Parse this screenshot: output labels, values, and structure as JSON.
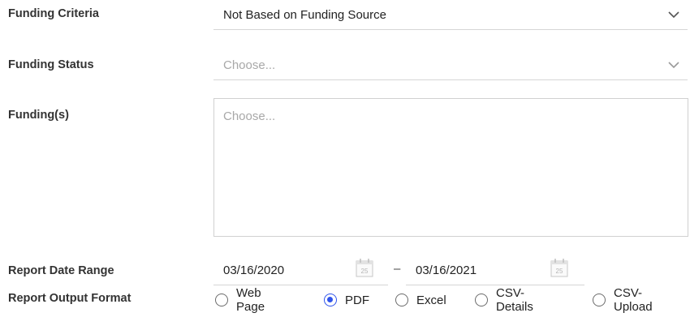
{
  "funding_criteria": {
    "label": "Funding Criteria",
    "value": "Not Based on Funding Source",
    "icon": "chevron-down-icon"
  },
  "funding_status": {
    "label": "Funding Status",
    "placeholder": "Choose...",
    "icon": "chevron-down-icon"
  },
  "fundings": {
    "label": "Funding(s)",
    "placeholder": "Choose..."
  },
  "report_date_range": {
    "label": "Report Date Range",
    "start": "03/16/2020",
    "separator": "–",
    "end": "03/16/2021",
    "calendar_icon_day": "25",
    "icon": "calendar-icon"
  },
  "report_output_format": {
    "label": "Report Output Format",
    "options": [
      "Web Page",
      "PDF",
      "Excel",
      "CSV-Details",
      "CSV-Upload"
    ],
    "selected": "PDF",
    "accent_color": "#2f54eb"
  }
}
